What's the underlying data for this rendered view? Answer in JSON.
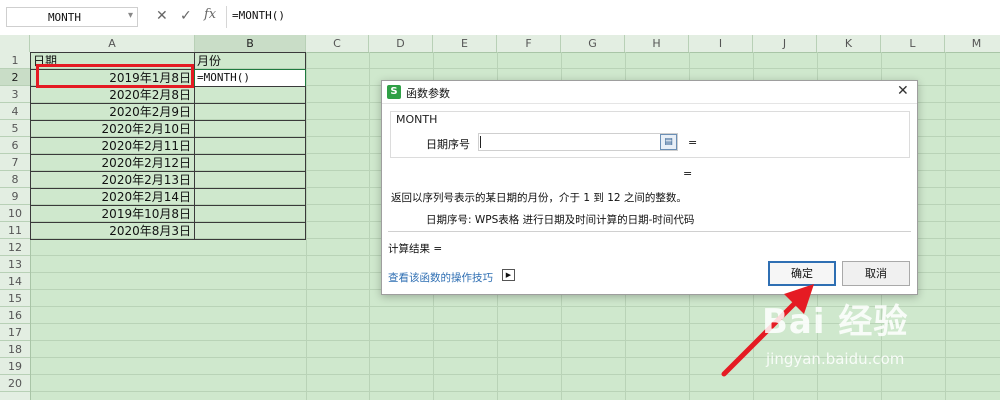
{
  "formula_bar": {
    "name_box": "MONTH",
    "cancel_icon": "✕",
    "confirm_icon": "✓",
    "fx_label": "fx",
    "formula": "=MONTH()"
  },
  "sheet": {
    "columns": [
      "A",
      "B",
      "C",
      "D",
      "E",
      "F",
      "G",
      "H",
      "I",
      "J",
      "K",
      "L",
      "M"
    ],
    "rows": [
      "1",
      "2",
      "3",
      "4",
      "5",
      "6",
      "7",
      "8",
      "9",
      "10",
      "11",
      "12",
      "13",
      "14",
      "15",
      "16",
      "17",
      "18",
      "19",
      "20"
    ],
    "header_a": "日期",
    "header_b": "月份",
    "active_formula": "=MONTH()",
    "dates": [
      "2019年1月8日",
      "2020年2月8日",
      "2020年2月9日",
      "2020年2月10日",
      "2020年2月11日",
      "2020年2月12日",
      "2020年2月13日",
      "2020年2月14日",
      "2019年10月8日",
      "2020年8月3日"
    ]
  },
  "dialog": {
    "title": "函数参数",
    "function_name": "MONTH",
    "arg_label": "日期序号",
    "arg_value": "",
    "arg_equals": "=",
    "result_equals": "=",
    "description": "返回以序列号表示的某日期的月份，介于 1 到 12 之间的整数。",
    "param_description": "日期序号:   WPS表格 进行日期及时间计算的日期-时间代码",
    "calc_result": "计算结果  =",
    "tips_link": "查看该函数的操作技巧",
    "ok": "确定",
    "cancel": "取消"
  },
  "watermark": {
    "main": "Bai 经验",
    "sub": "jingyan.baidu.com"
  },
  "colors": {
    "sheet_bg": "#cfe8cd",
    "highlight": "#e51b23",
    "arrow": "#e51b23",
    "link": "#2f6fb3",
    "logo": "#2fa046"
  }
}
